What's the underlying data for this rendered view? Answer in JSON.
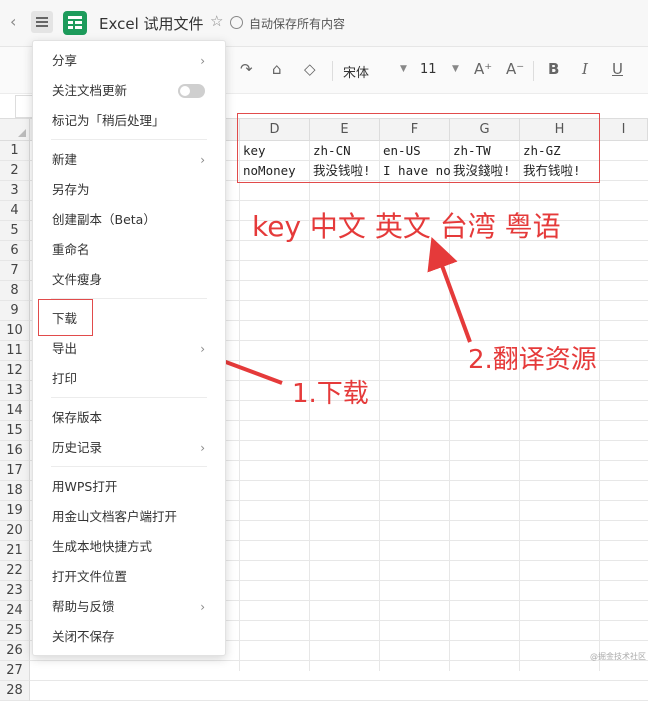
{
  "title_bar": {
    "doc_title": "Excel 试用文件",
    "autosave": "自动保存所有内容",
    "back_icon": "chevron-left-icon",
    "menu_icon": "hamburger-icon",
    "star_icon": "star-icon"
  },
  "toolbar": {
    "font_name": "宋体",
    "font_size": "11",
    "grow": "A⁺",
    "shrink": "A⁻",
    "bold": "B",
    "italic": "I",
    "underline": "U"
  },
  "sheet": {
    "column_headers": [
      "D",
      "E",
      "F",
      "G",
      "H",
      "I"
    ],
    "row_headers": [
      "1",
      "2",
      "3",
      "4",
      "5",
      "6",
      "7",
      "8",
      "9",
      "10",
      "11",
      "12",
      "13",
      "14",
      "15",
      "16",
      "17",
      "18",
      "19",
      "20",
      "21",
      "22",
      "23",
      "24",
      "25",
      "26",
      "27",
      "28"
    ],
    "rows": [
      [
        "key",
        "zh-CN",
        "en-US",
        "zh-TW",
        "zh-GZ"
      ],
      [
        "noMoney",
        "我没钱啦!",
        "I have no",
        "我沒錢啦!",
        "我冇钱啦!"
      ]
    ]
  },
  "menu": {
    "items": [
      {
        "label": "分享",
        "chevron": true
      },
      {
        "label": "关注文档更新",
        "toggle": true
      },
      {
        "label": "标记为「稍后处理」"
      },
      {
        "label": "新建",
        "chevron": true
      },
      {
        "label": "另存为"
      },
      {
        "label": "创建副本（Beta）"
      },
      {
        "label": "重命名"
      },
      {
        "label": "文件瘦身"
      },
      {
        "label": "下载"
      },
      {
        "label": "导出",
        "chevron": true
      },
      {
        "label": "打印"
      },
      {
        "label": "保存版本"
      },
      {
        "label": "历史记录",
        "chevron": true
      },
      {
        "label": "用WPS打开"
      },
      {
        "label": "用金山文档客户端打开"
      },
      {
        "label": "生成本地快捷方式"
      },
      {
        "label": "打开文件位置"
      },
      {
        "label": "帮助与反馈",
        "chevron": true
      },
      {
        "label": "关闭不保存"
      }
    ]
  },
  "annotations": {
    "langs": "key 中文 英文 台湾 粤语",
    "step2": "2.翻译资源",
    "step1": "1.下载",
    "color": "#e53a3a"
  },
  "watermark": "@掘金技术社区"
}
